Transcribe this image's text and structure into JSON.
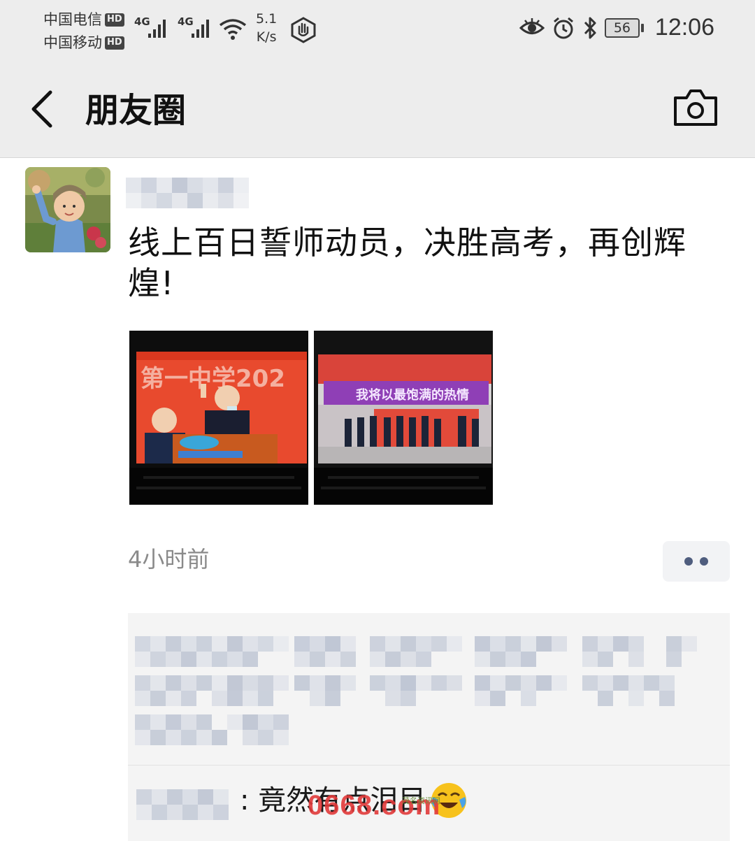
{
  "status_bar": {
    "carrier1": "中国电信",
    "carrier2": "中国移动",
    "hd_badge": "HD",
    "network1": "4G",
    "network2": "4G",
    "speed_value": "5.1",
    "speed_unit": "K/s",
    "battery": "56",
    "time": "12:06"
  },
  "nav": {
    "title": "朋友圈"
  },
  "post": {
    "text": "线上百日誓师动员，决胜高考，再创辉煌!",
    "time_ago": "4小时前",
    "photos": [
      {
        "banner": "第一中学202"
      },
      {
        "banner": "我将以最饱满的热情"
      }
    ]
  },
  "comments": {
    "second_comment_text": ": 竟然有点泪目"
  },
  "watermark": {
    "text": "0668.com",
    "small": "茂名资讯网"
  },
  "colors": {
    "header_bg": "#ededed",
    "comment_bg": "#f4f4f4",
    "time_gray": "#8a8a8a",
    "more_dot": "#4f5d7e",
    "watermark_red": "#e23a3a"
  }
}
